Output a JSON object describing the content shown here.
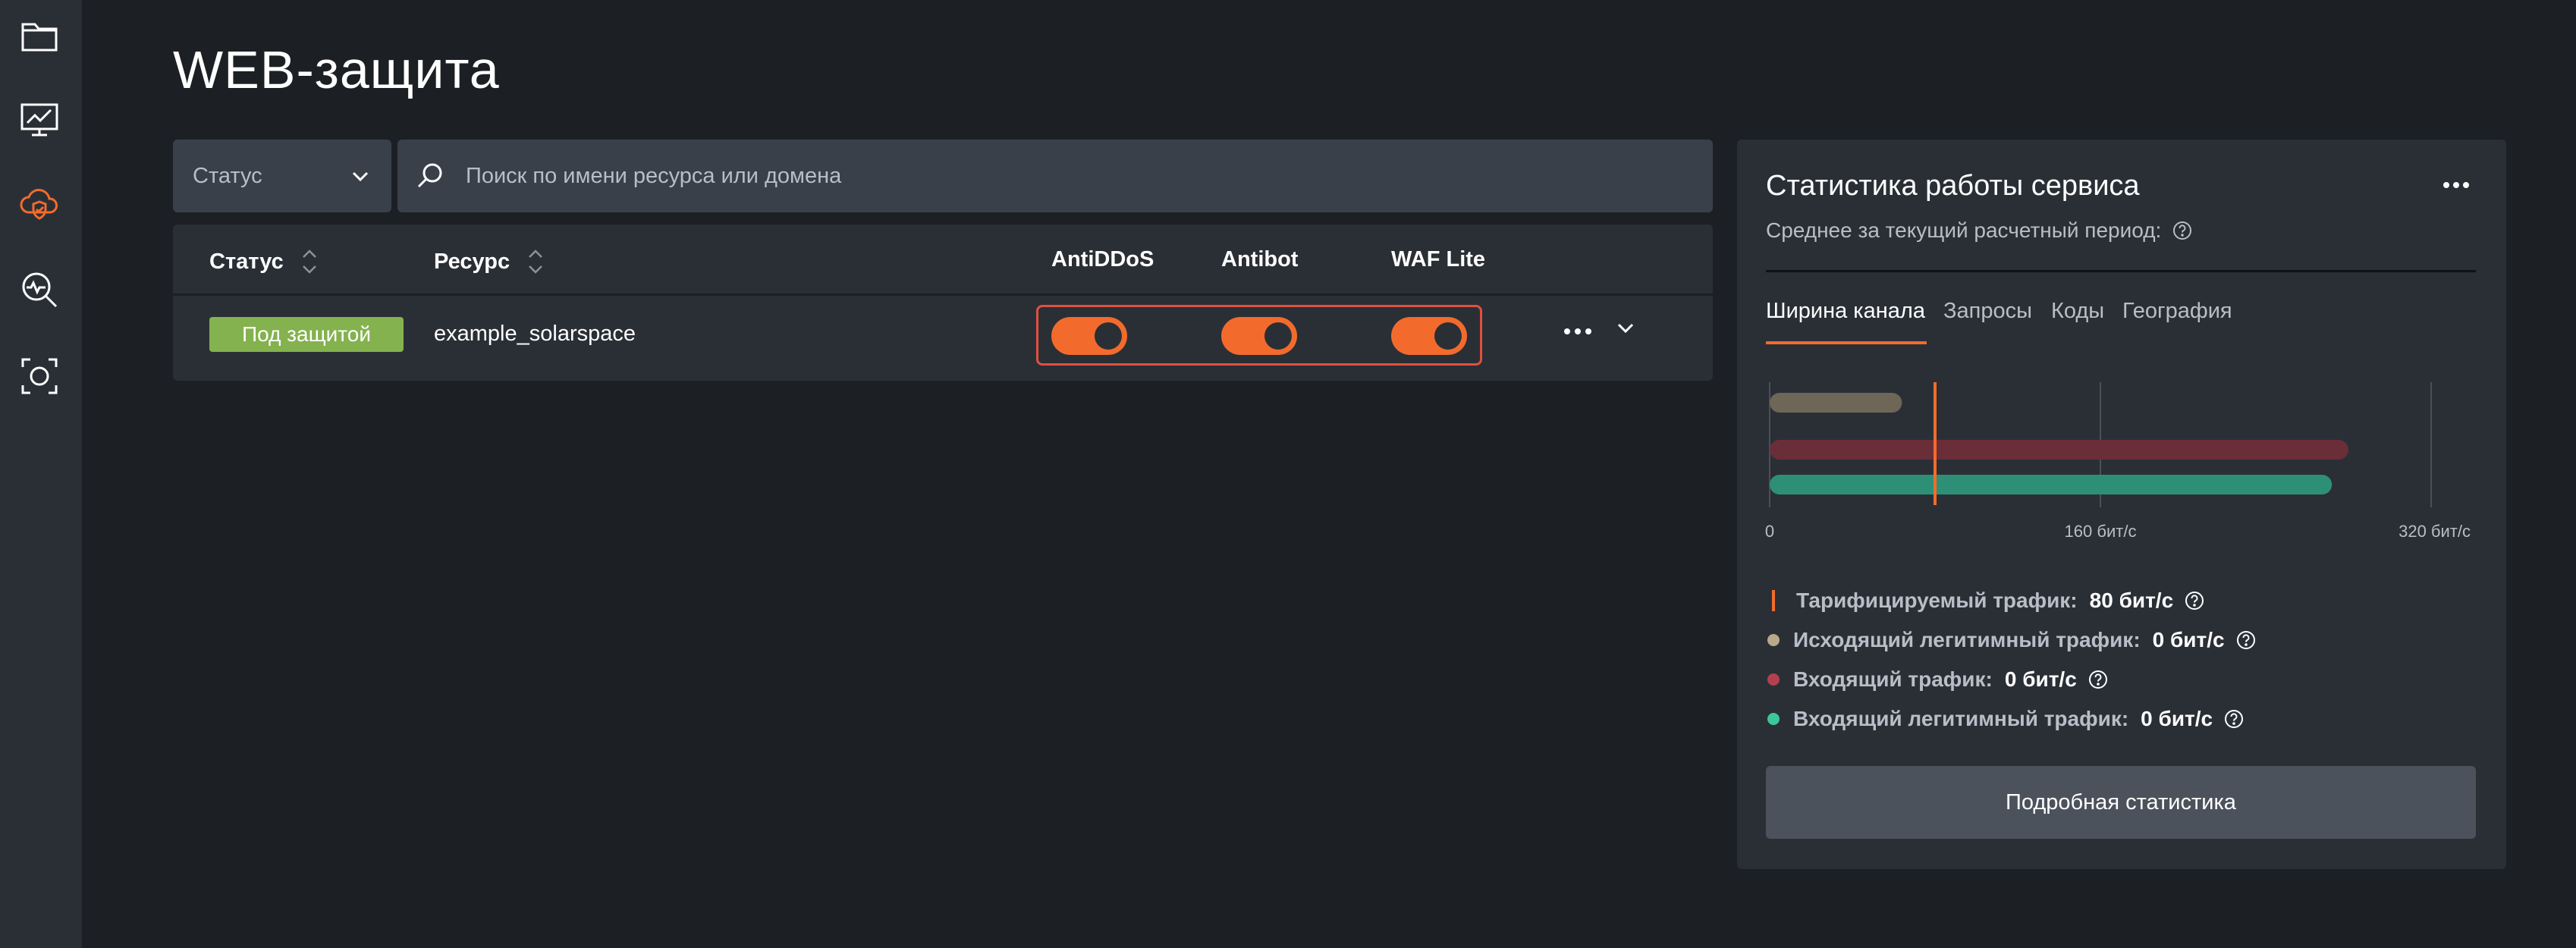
{
  "page": {
    "title": "WEB-защита"
  },
  "sidebar": {
    "items": [
      {
        "icon": "folder-icon"
      },
      {
        "icon": "monitor-chart-icon"
      },
      {
        "icon": "cloud-shield-icon",
        "active": true
      },
      {
        "icon": "search-pulse-icon"
      },
      {
        "icon": "scan-frame-icon"
      }
    ]
  },
  "filters": {
    "status_label": "Статус",
    "search_placeholder": "Поиск по имени ресурса или домена"
  },
  "table": {
    "headers": {
      "status": "Статус",
      "resource": "Ресурс",
      "antiddos": "AntiDDoS",
      "antibot": "Antibot",
      "waf": "WAF Lite"
    },
    "rows": [
      {
        "status": "Под защитой",
        "resource": "example_solarspace",
        "antiddos": true,
        "antibot": true,
        "waf": true
      }
    ]
  },
  "stats": {
    "title": "Статистика работы сервиса",
    "subtitle": "Среднее за текущий расчетный период:",
    "tabs": [
      "Ширина канала",
      "Запросы",
      "Коды",
      "География"
    ],
    "active_tab": 0,
    "details_button": "Подробная статистика",
    "legend": [
      {
        "label": "Тарифицируемый трафик:",
        "value": "80 бит/с",
        "color": "#f26b2c"
      },
      {
        "label": "Исходящий легитимный трафик:",
        "value": "0 бит/с",
        "color": "#b7a98a"
      },
      {
        "label": "Входящий трафик:",
        "value": "0 бит/с",
        "color": "#b3404e"
      },
      {
        "label": "Входящий легитимный трафик:",
        "value": "0 бит/с",
        "color": "#3cc79a"
      }
    ]
  },
  "chart_data": {
    "type": "bar",
    "orientation": "horizontal",
    "x_ticks": [
      "0",
      "160 бит/с",
      "320 бит/с"
    ],
    "xlim": [
      0,
      320
    ],
    "marker_line": {
      "value": 80,
      "color": "#f26b2c"
    },
    "series": [
      {
        "value": 64,
        "color": "#6e6656"
      },
      {
        "value": 280,
        "color": "#6a2e39"
      },
      {
        "value": 272,
        "color": "#2e8f77"
      }
    ]
  }
}
